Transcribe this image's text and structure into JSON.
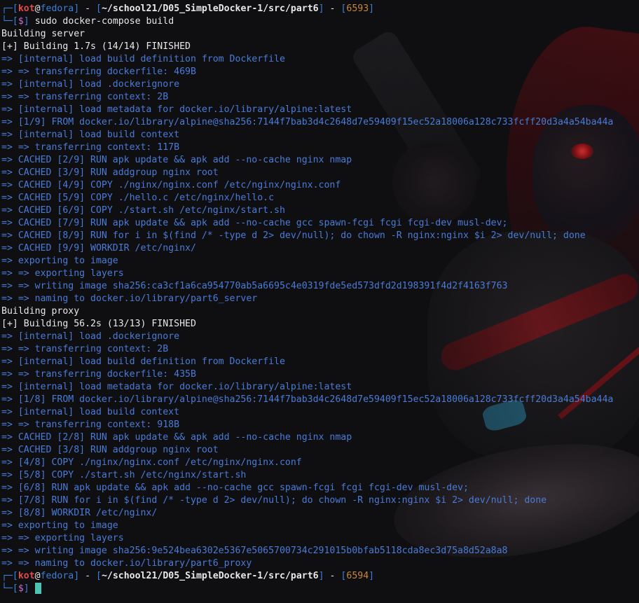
{
  "prompt1": {
    "user": "kot",
    "host": "fedora",
    "path": "~/school21/D05_SimpleDocker-1/src/part6",
    "pid": "6593",
    "command": "sudo docker-compose build"
  },
  "server": {
    "heading": "Building server",
    "summary": "[+] Building 1.7s (14/14) FINISHED",
    "steps": [
      "=> [internal] load build definition from Dockerfile",
      "=> => transferring dockerfile: 469B",
      "=> [internal] load .dockerignore",
      "=> => transferring context: 2B",
      "=> [internal] load metadata for docker.io/library/alpine:latest",
      "=> [1/9] FROM docker.io/library/alpine@sha256:7144f7bab3d4c2648d7e59409f15ec52a18006a128c733fcff20d3a4a54ba44a",
      "=> [internal] load build context",
      "=> => transferring context: 117B",
      "=> CACHED [2/9] RUN apk update && apk add --no-cache nginx nmap",
      "=> CACHED [3/9] RUN addgroup nginx root",
      "=> CACHED [4/9] COPY ./nginx/nginx.conf /etc/nginx/nginx.conf",
      "=> CACHED [5/9] COPY ./hello.c /etc/nginx/hello.c",
      "=> CACHED [6/9] COPY ./start.sh /etc/nginx/start.sh",
      "=> CACHED [7/9] RUN apk update && apk add --no-cache gcc spawn-fcgi fcgi fcgi-dev musl-dev;",
      "=> CACHED [8/9] RUN for i in $(find /* -type d 2> dev/null); do chown -R nginx:nginx $i 2> dev/null; done",
      "=> CACHED [9/9] WORKDIR /etc/nginx/",
      "=> exporting to image",
      "=> => exporting layers",
      "=> => writing image sha256:ca3cf1a6ca954770ab5a6695c4e0319fde5ed573dfd2d198391f4d2f4163f763",
      "=> => naming to docker.io/library/part6_server"
    ]
  },
  "proxy": {
    "heading": "Building proxy",
    "summary": "[+] Building 56.2s (13/13) FINISHED",
    "steps": [
      "=> [internal] load .dockerignore",
      "=> => transferring context: 2B",
      "=> [internal] load build definition from Dockerfile",
      "=> => transferring dockerfile: 435B",
      "=> [internal] load metadata for docker.io/library/alpine:latest",
      "=> [1/8] FROM docker.io/library/alpine@sha256:7144f7bab3d4c2648d7e59409f15ec52a18006a128c733fcff20d3a4a54ba44a",
      "=> [internal] load build context",
      "=> => transferring context: 918B",
      "=> CACHED [2/8] RUN apk update && apk add --no-cache nginx nmap",
      "=> CACHED [3/8] RUN addgroup nginx root",
      "=> [4/8] COPY ./nginx/nginx.conf /etc/nginx/nginx.conf",
      "=> [5/8] COPY ./start.sh /etc/nginx/start.sh",
      "=> [6/8] RUN apk update && apk add --no-cache gcc spawn-fcgi fcgi fcgi-dev musl-dev;",
      "=> [7/8] RUN for i in $(find /* -type d 2> dev/null); do chown -R nginx:nginx $i 2> dev/null; done",
      "=> [8/8] WORKDIR /etc/nginx/",
      "=> exporting to image",
      "=> => exporting layers",
      "=> => writing image sha256:9e524bea6302e5367e5065700734c291015b0bfab5118cda8ec3d75a8d52a8a8",
      "=> => naming to docker.io/library/part6_proxy"
    ]
  },
  "prompt2": {
    "user": "kot",
    "host": "fedora",
    "path": "~/school21/D05_SimpleDocker-1/src/part6",
    "pid": "6594"
  },
  "colors": {
    "accent": "#3b7fd6",
    "step": "#3b6fbf",
    "user": "#e04a4a",
    "cursor": "#4ec4b2"
  }
}
